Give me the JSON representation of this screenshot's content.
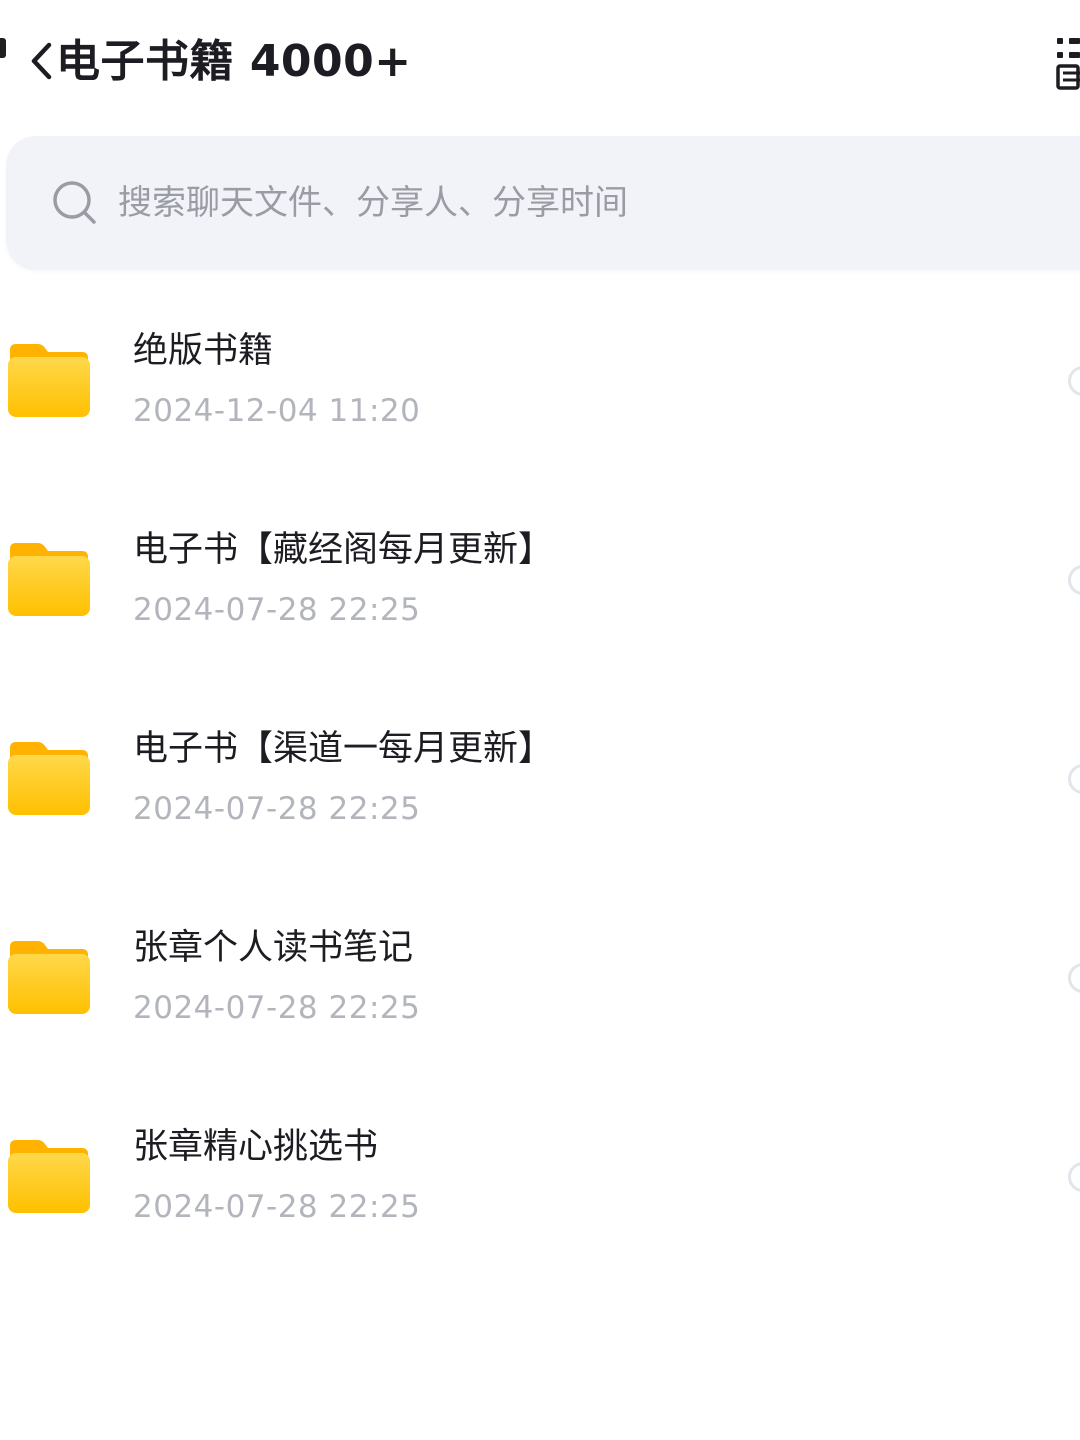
{
  "header": {
    "title": "电子书籍 4000+",
    "back_icon": "chevron-left-icon",
    "view_toggle_icon": "grid-list-icon"
  },
  "search": {
    "placeholder": "搜索聊天文件、分享人、分享时间",
    "icon": "search-icon"
  },
  "colors": {
    "folder": "#FFC61A",
    "folder_tab": "#FFB400",
    "search_bg": "#F2F3F8",
    "title_text": "#1C1C22",
    "meta_text": "#B3B5BC"
  },
  "files": [
    {
      "name": "绝版书籍",
      "time": "2024-12-04 11:20",
      "icon": "folder-icon"
    },
    {
      "name": "电子书【藏经阁每月更新】",
      "time": "2024-07-28 22:25",
      "icon": "folder-icon"
    },
    {
      "name": "电子书【渠道一每月更新】",
      "time": "2024-07-28 22:25",
      "icon": "folder-icon"
    },
    {
      "name": "张章个人读书笔记",
      "time": "2024-07-28 22:25",
      "icon": "folder-icon"
    },
    {
      "name": "张章精心挑选书",
      "time": "2024-07-28 22:25",
      "icon": "folder-icon"
    }
  ]
}
